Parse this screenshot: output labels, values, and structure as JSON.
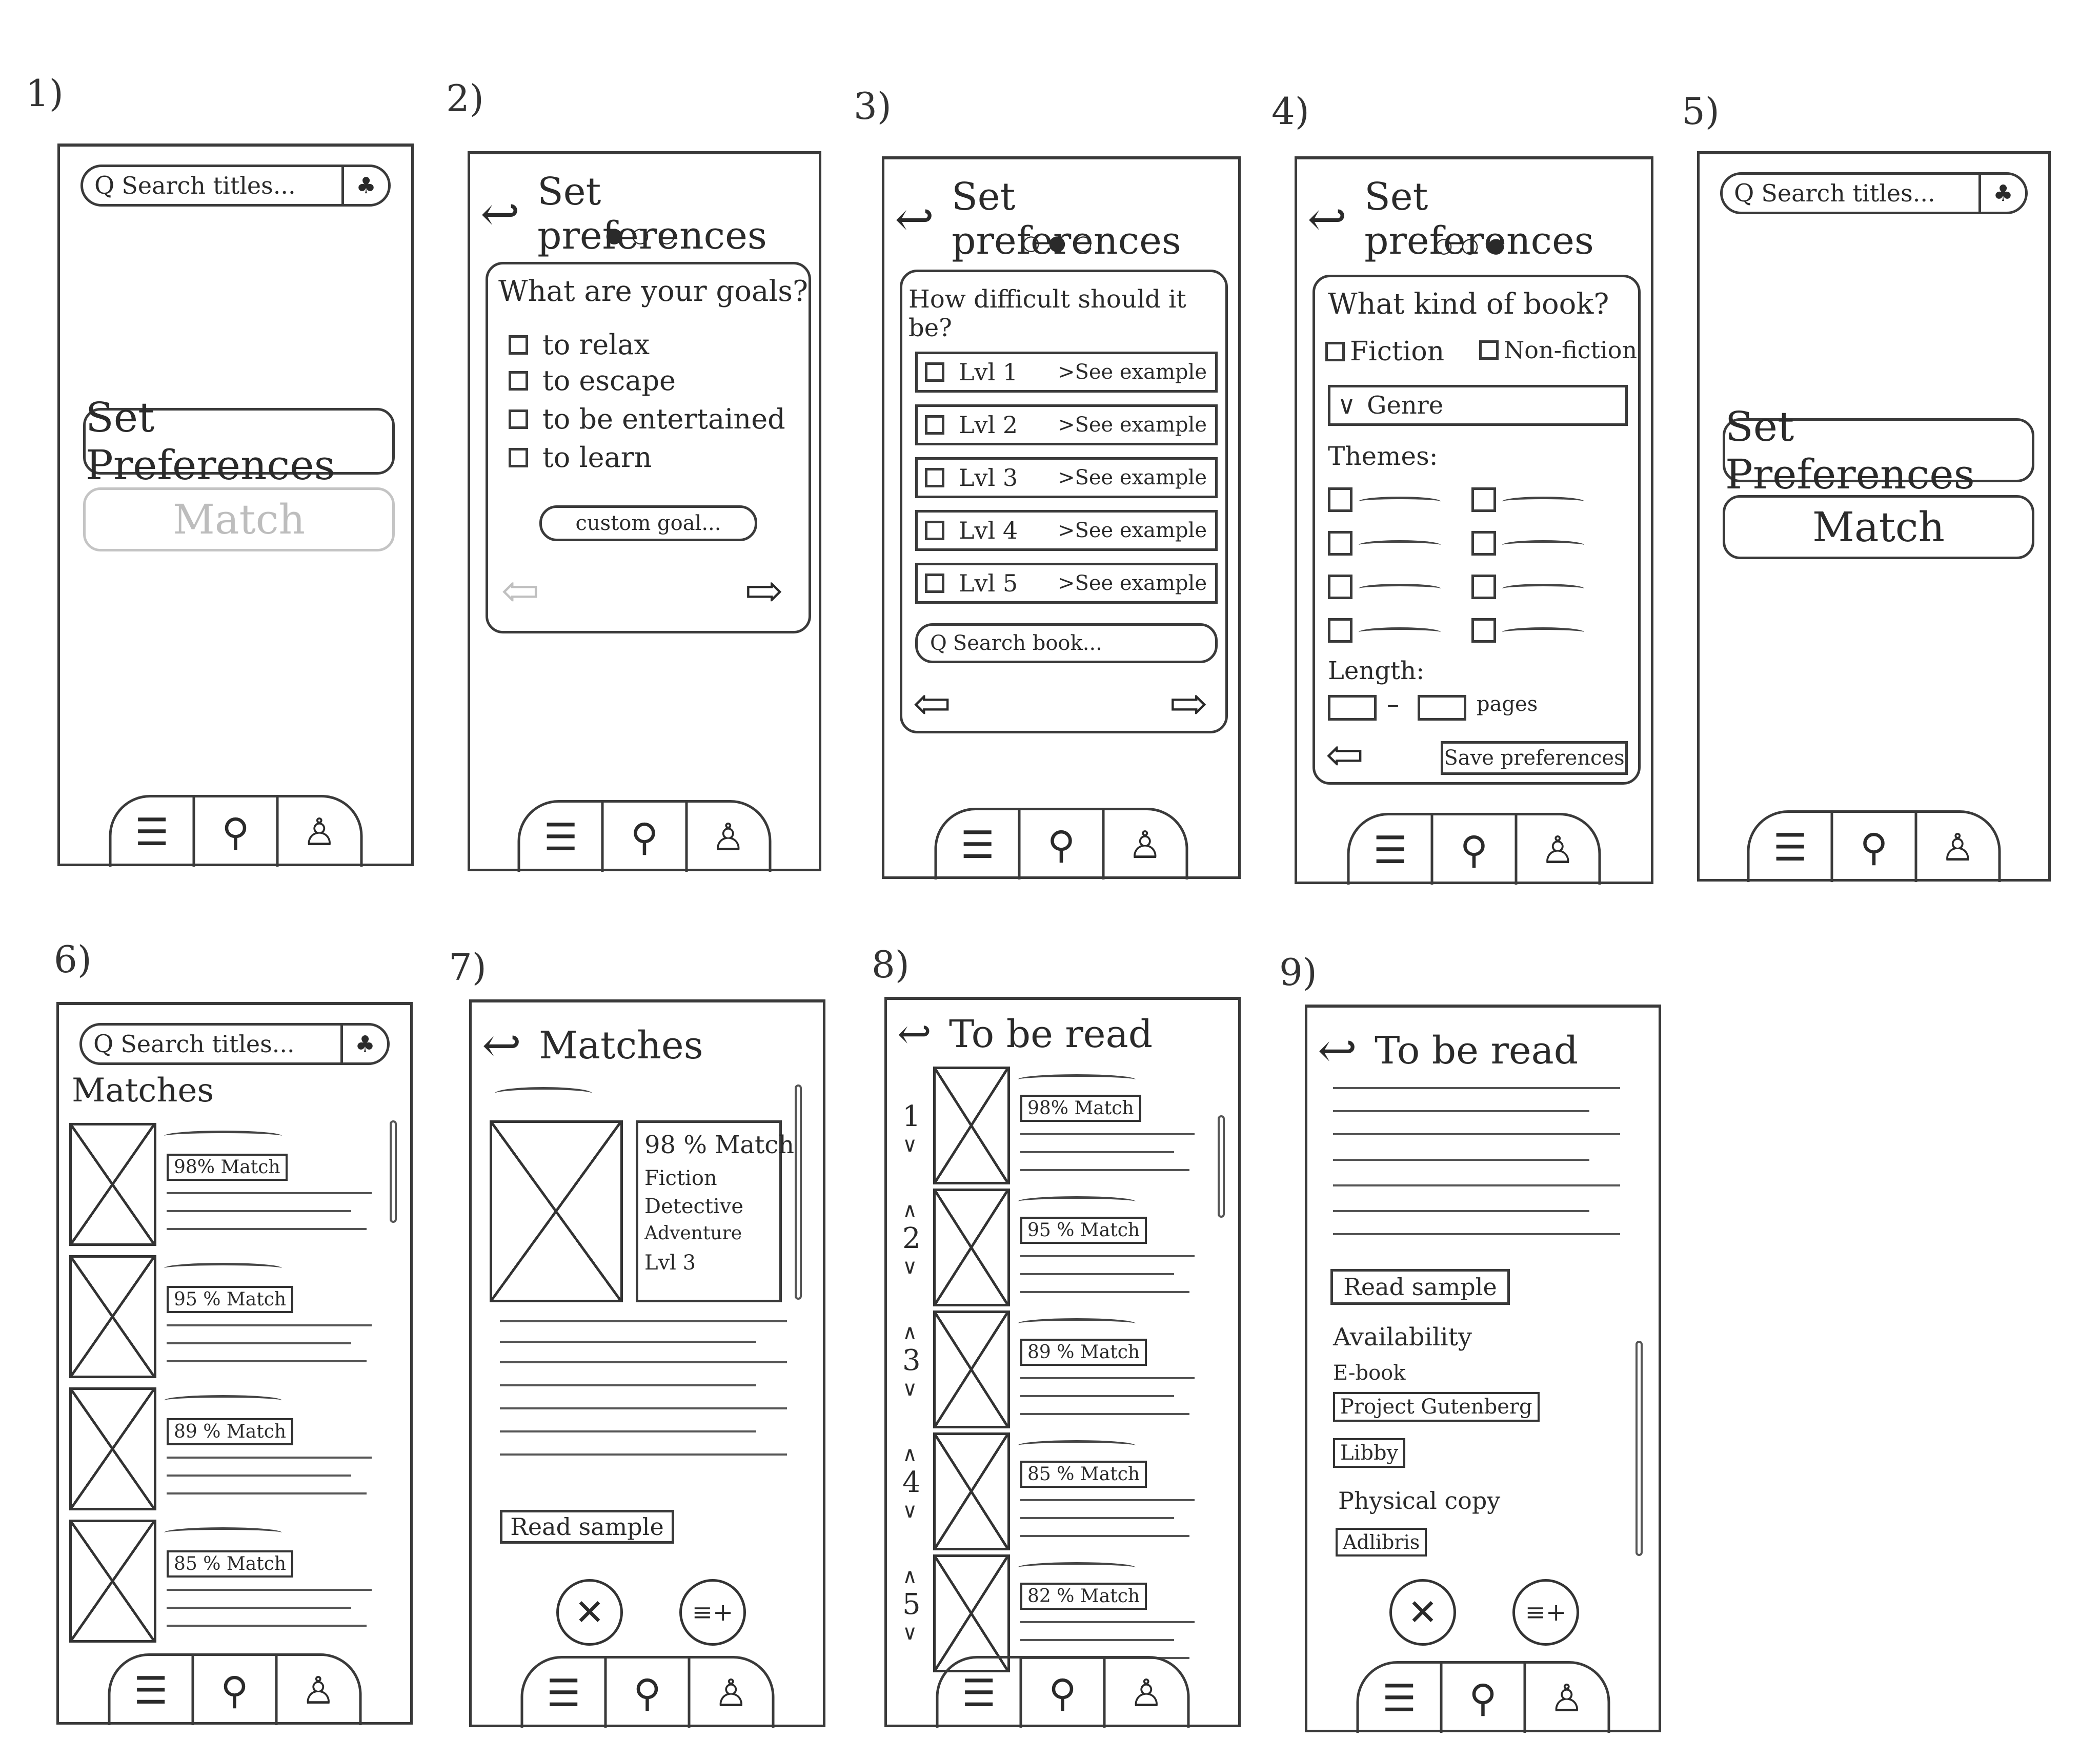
{
  "screens": {
    "n1": "1)",
    "n2": "2)",
    "n3": "3)",
    "n4": "4)",
    "n5": "5)",
    "n6": "6)",
    "n7": "7)",
    "n8": "8)",
    "n9": "9)"
  },
  "search": {
    "placeholder": "Search titles...",
    "search_icon": "Q",
    "assistant_icon": "♣"
  },
  "home": {
    "set_preferences": "Set Preferences",
    "match": "Match"
  },
  "nav": {
    "list_icon": "☰",
    "search_icon": "⚲",
    "profile_icon": "♙"
  },
  "icons": {
    "back": "↩",
    "prev_arrow": "⇦",
    "next_arrow": "⇨",
    "close": "✕",
    "add_list": "≡+"
  },
  "prefs": {
    "title": "Set preferences",
    "dots1": "●○○",
    "dots2": "○●○",
    "dots3": "○○●",
    "goals_q": "What are your goals?",
    "goals": [
      "to relax",
      "to escape",
      "to be entertained",
      "to learn"
    ],
    "custom_goal": "custom goal...",
    "difficulty_q": "How difficult should it be?",
    "levels": [
      "Lvl 1",
      "Lvl 2",
      "Lvl 3",
      "Lvl 4",
      "Lvl 5"
    ],
    "see_example": ">See example",
    "search_book": "Search book...",
    "kind_q": "What kind of book?",
    "fiction": "Fiction",
    "nonfiction": "Non-fiction",
    "genre": "Genre",
    "genre_icon": "∨",
    "themes": "Themes:",
    "length": "Length:",
    "length_dash": "–",
    "pages": "pages",
    "save": "Save preferences"
  },
  "matches": {
    "title": "Matches",
    "items": [
      "98% Match",
      "95 % Match",
      "89 % Match",
      "85 % Match"
    ],
    "detail_title": "Matches",
    "detail_info": [
      "98 % Match",
      "Fiction",
      "Detective",
      "Adventure",
      "Lvl 3"
    ],
    "read_sample": "Read sample"
  },
  "tbr": {
    "title": "To be read",
    "ranks": [
      "1",
      "2",
      "3",
      "4",
      "5"
    ],
    "items": [
      "98% Match",
      "95 % Match",
      "89 % Match",
      "85 % Match",
      "82 % Match"
    ],
    "up": "∧",
    "down": "∨",
    "read_sample": "Read sample",
    "availability": "Availability",
    "ebook": "E-book",
    "project_gutenberg": "Project Gutenberg",
    "libby": "Libby",
    "physical_copy": "Physical copy",
    "adlibris": "Adlibris"
  }
}
